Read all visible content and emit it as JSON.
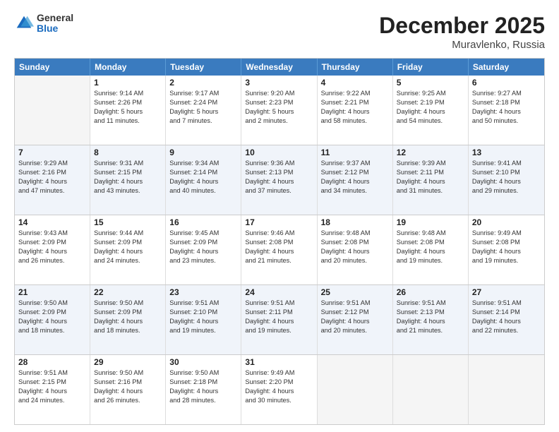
{
  "logo": {
    "general": "General",
    "blue": "Blue"
  },
  "title": {
    "month": "December 2025",
    "location": "Muravlenko, Russia"
  },
  "header_days": [
    "Sunday",
    "Monday",
    "Tuesday",
    "Wednesday",
    "Thursday",
    "Friday",
    "Saturday"
  ],
  "rows": [
    [
      {
        "day": "",
        "lines": [],
        "empty": true
      },
      {
        "day": "1",
        "lines": [
          "Sunrise: 9:14 AM",
          "Sunset: 2:26 PM",
          "Daylight: 5 hours",
          "and 11 minutes."
        ]
      },
      {
        "day": "2",
        "lines": [
          "Sunrise: 9:17 AM",
          "Sunset: 2:24 PM",
          "Daylight: 5 hours",
          "and 7 minutes."
        ]
      },
      {
        "day": "3",
        "lines": [
          "Sunrise: 9:20 AM",
          "Sunset: 2:23 PM",
          "Daylight: 5 hours",
          "and 2 minutes."
        ]
      },
      {
        "day": "4",
        "lines": [
          "Sunrise: 9:22 AM",
          "Sunset: 2:21 PM",
          "Daylight: 4 hours",
          "and 58 minutes."
        ]
      },
      {
        "day": "5",
        "lines": [
          "Sunrise: 9:25 AM",
          "Sunset: 2:19 PM",
          "Daylight: 4 hours",
          "and 54 minutes."
        ]
      },
      {
        "day": "6",
        "lines": [
          "Sunrise: 9:27 AM",
          "Sunset: 2:18 PM",
          "Daylight: 4 hours",
          "and 50 minutes."
        ]
      }
    ],
    [
      {
        "day": "7",
        "lines": [
          "Sunrise: 9:29 AM",
          "Sunset: 2:16 PM",
          "Daylight: 4 hours",
          "and 47 minutes."
        ]
      },
      {
        "day": "8",
        "lines": [
          "Sunrise: 9:31 AM",
          "Sunset: 2:15 PM",
          "Daylight: 4 hours",
          "and 43 minutes."
        ]
      },
      {
        "day": "9",
        "lines": [
          "Sunrise: 9:34 AM",
          "Sunset: 2:14 PM",
          "Daylight: 4 hours",
          "and 40 minutes."
        ]
      },
      {
        "day": "10",
        "lines": [
          "Sunrise: 9:36 AM",
          "Sunset: 2:13 PM",
          "Daylight: 4 hours",
          "and 37 minutes."
        ]
      },
      {
        "day": "11",
        "lines": [
          "Sunrise: 9:37 AM",
          "Sunset: 2:12 PM",
          "Daylight: 4 hours",
          "and 34 minutes."
        ]
      },
      {
        "day": "12",
        "lines": [
          "Sunrise: 9:39 AM",
          "Sunset: 2:11 PM",
          "Daylight: 4 hours",
          "and 31 minutes."
        ]
      },
      {
        "day": "13",
        "lines": [
          "Sunrise: 9:41 AM",
          "Sunset: 2:10 PM",
          "Daylight: 4 hours",
          "and 29 minutes."
        ]
      }
    ],
    [
      {
        "day": "14",
        "lines": [
          "Sunrise: 9:43 AM",
          "Sunset: 2:09 PM",
          "Daylight: 4 hours",
          "and 26 minutes."
        ]
      },
      {
        "day": "15",
        "lines": [
          "Sunrise: 9:44 AM",
          "Sunset: 2:09 PM",
          "Daylight: 4 hours",
          "and 24 minutes."
        ]
      },
      {
        "day": "16",
        "lines": [
          "Sunrise: 9:45 AM",
          "Sunset: 2:09 PM",
          "Daylight: 4 hours",
          "and 23 minutes."
        ]
      },
      {
        "day": "17",
        "lines": [
          "Sunrise: 9:46 AM",
          "Sunset: 2:08 PM",
          "Daylight: 4 hours",
          "and 21 minutes."
        ]
      },
      {
        "day": "18",
        "lines": [
          "Sunrise: 9:48 AM",
          "Sunset: 2:08 PM",
          "Daylight: 4 hours",
          "and 20 minutes."
        ]
      },
      {
        "day": "19",
        "lines": [
          "Sunrise: 9:48 AM",
          "Sunset: 2:08 PM",
          "Daylight: 4 hours",
          "and 19 minutes."
        ]
      },
      {
        "day": "20",
        "lines": [
          "Sunrise: 9:49 AM",
          "Sunset: 2:08 PM",
          "Daylight: 4 hours",
          "and 19 minutes."
        ]
      }
    ],
    [
      {
        "day": "21",
        "lines": [
          "Sunrise: 9:50 AM",
          "Sunset: 2:09 PM",
          "Daylight: 4 hours",
          "and 18 minutes."
        ]
      },
      {
        "day": "22",
        "lines": [
          "Sunrise: 9:50 AM",
          "Sunset: 2:09 PM",
          "Daylight: 4 hours",
          "and 18 minutes."
        ]
      },
      {
        "day": "23",
        "lines": [
          "Sunrise: 9:51 AM",
          "Sunset: 2:10 PM",
          "Daylight: 4 hours",
          "and 19 minutes."
        ]
      },
      {
        "day": "24",
        "lines": [
          "Sunrise: 9:51 AM",
          "Sunset: 2:11 PM",
          "Daylight: 4 hours",
          "and 19 minutes."
        ]
      },
      {
        "day": "25",
        "lines": [
          "Sunrise: 9:51 AM",
          "Sunset: 2:12 PM",
          "Daylight: 4 hours",
          "and 20 minutes."
        ]
      },
      {
        "day": "26",
        "lines": [
          "Sunrise: 9:51 AM",
          "Sunset: 2:13 PM",
          "Daylight: 4 hours",
          "and 21 minutes."
        ]
      },
      {
        "day": "27",
        "lines": [
          "Sunrise: 9:51 AM",
          "Sunset: 2:14 PM",
          "Daylight: 4 hours",
          "and 22 minutes."
        ]
      }
    ],
    [
      {
        "day": "28",
        "lines": [
          "Sunrise: 9:51 AM",
          "Sunset: 2:15 PM",
          "Daylight: 4 hours",
          "and 24 minutes."
        ]
      },
      {
        "day": "29",
        "lines": [
          "Sunrise: 9:50 AM",
          "Sunset: 2:16 PM",
          "Daylight: 4 hours",
          "and 26 minutes."
        ]
      },
      {
        "day": "30",
        "lines": [
          "Sunrise: 9:50 AM",
          "Sunset: 2:18 PM",
          "Daylight: 4 hours",
          "and 28 minutes."
        ]
      },
      {
        "day": "31",
        "lines": [
          "Sunrise: 9:49 AM",
          "Sunset: 2:20 PM",
          "Daylight: 4 hours",
          "and 30 minutes."
        ]
      },
      {
        "day": "",
        "lines": [],
        "empty": true
      },
      {
        "day": "",
        "lines": [],
        "empty": true
      },
      {
        "day": "",
        "lines": [],
        "empty": true
      }
    ]
  ]
}
